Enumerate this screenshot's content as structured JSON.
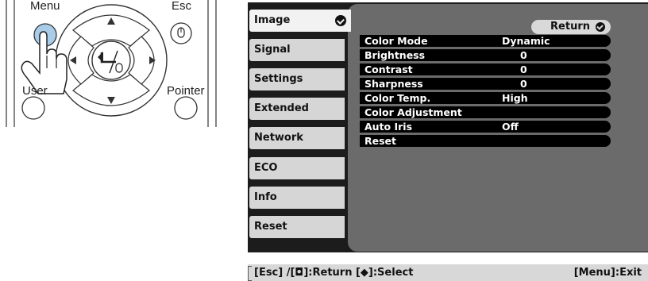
{
  "remote": {
    "menu_label": "Menu",
    "esc_label": "Esc",
    "user_label": "User",
    "pointer_label": "Pointer"
  },
  "tabs": [
    {
      "label": "Image",
      "active": true
    },
    {
      "label": "Signal",
      "active": false
    },
    {
      "label": "Settings",
      "active": false
    },
    {
      "label": "Extended",
      "active": false
    },
    {
      "label": "Network",
      "active": false
    },
    {
      "label": "ECO",
      "active": false
    },
    {
      "label": "Info",
      "active": false
    },
    {
      "label": "Reset",
      "active": false
    }
  ],
  "return_button": "Return",
  "items": [
    {
      "label": "Color Mode",
      "value": "Dynamic"
    },
    {
      "label": "Brightness",
      "value": "0"
    },
    {
      "label": "Contrast",
      "value": "0"
    },
    {
      "label": "Sharpness",
      "value": "0"
    },
    {
      "label": "Color Temp.",
      "value": "High"
    },
    {
      "label": "Color Adjustment",
      "value": ""
    },
    {
      "label": "Auto Iris",
      "value": "Off"
    },
    {
      "label": "Reset",
      "value": ""
    }
  ],
  "status": {
    "left": "[Esc] /[◘]:Return [◆]:Select",
    "right": "[Menu]:Exit"
  },
  "colors": {
    "menu_button": "#a9cde8",
    "panel": "#6b6b6b",
    "frame": "#1c1c1c"
  }
}
